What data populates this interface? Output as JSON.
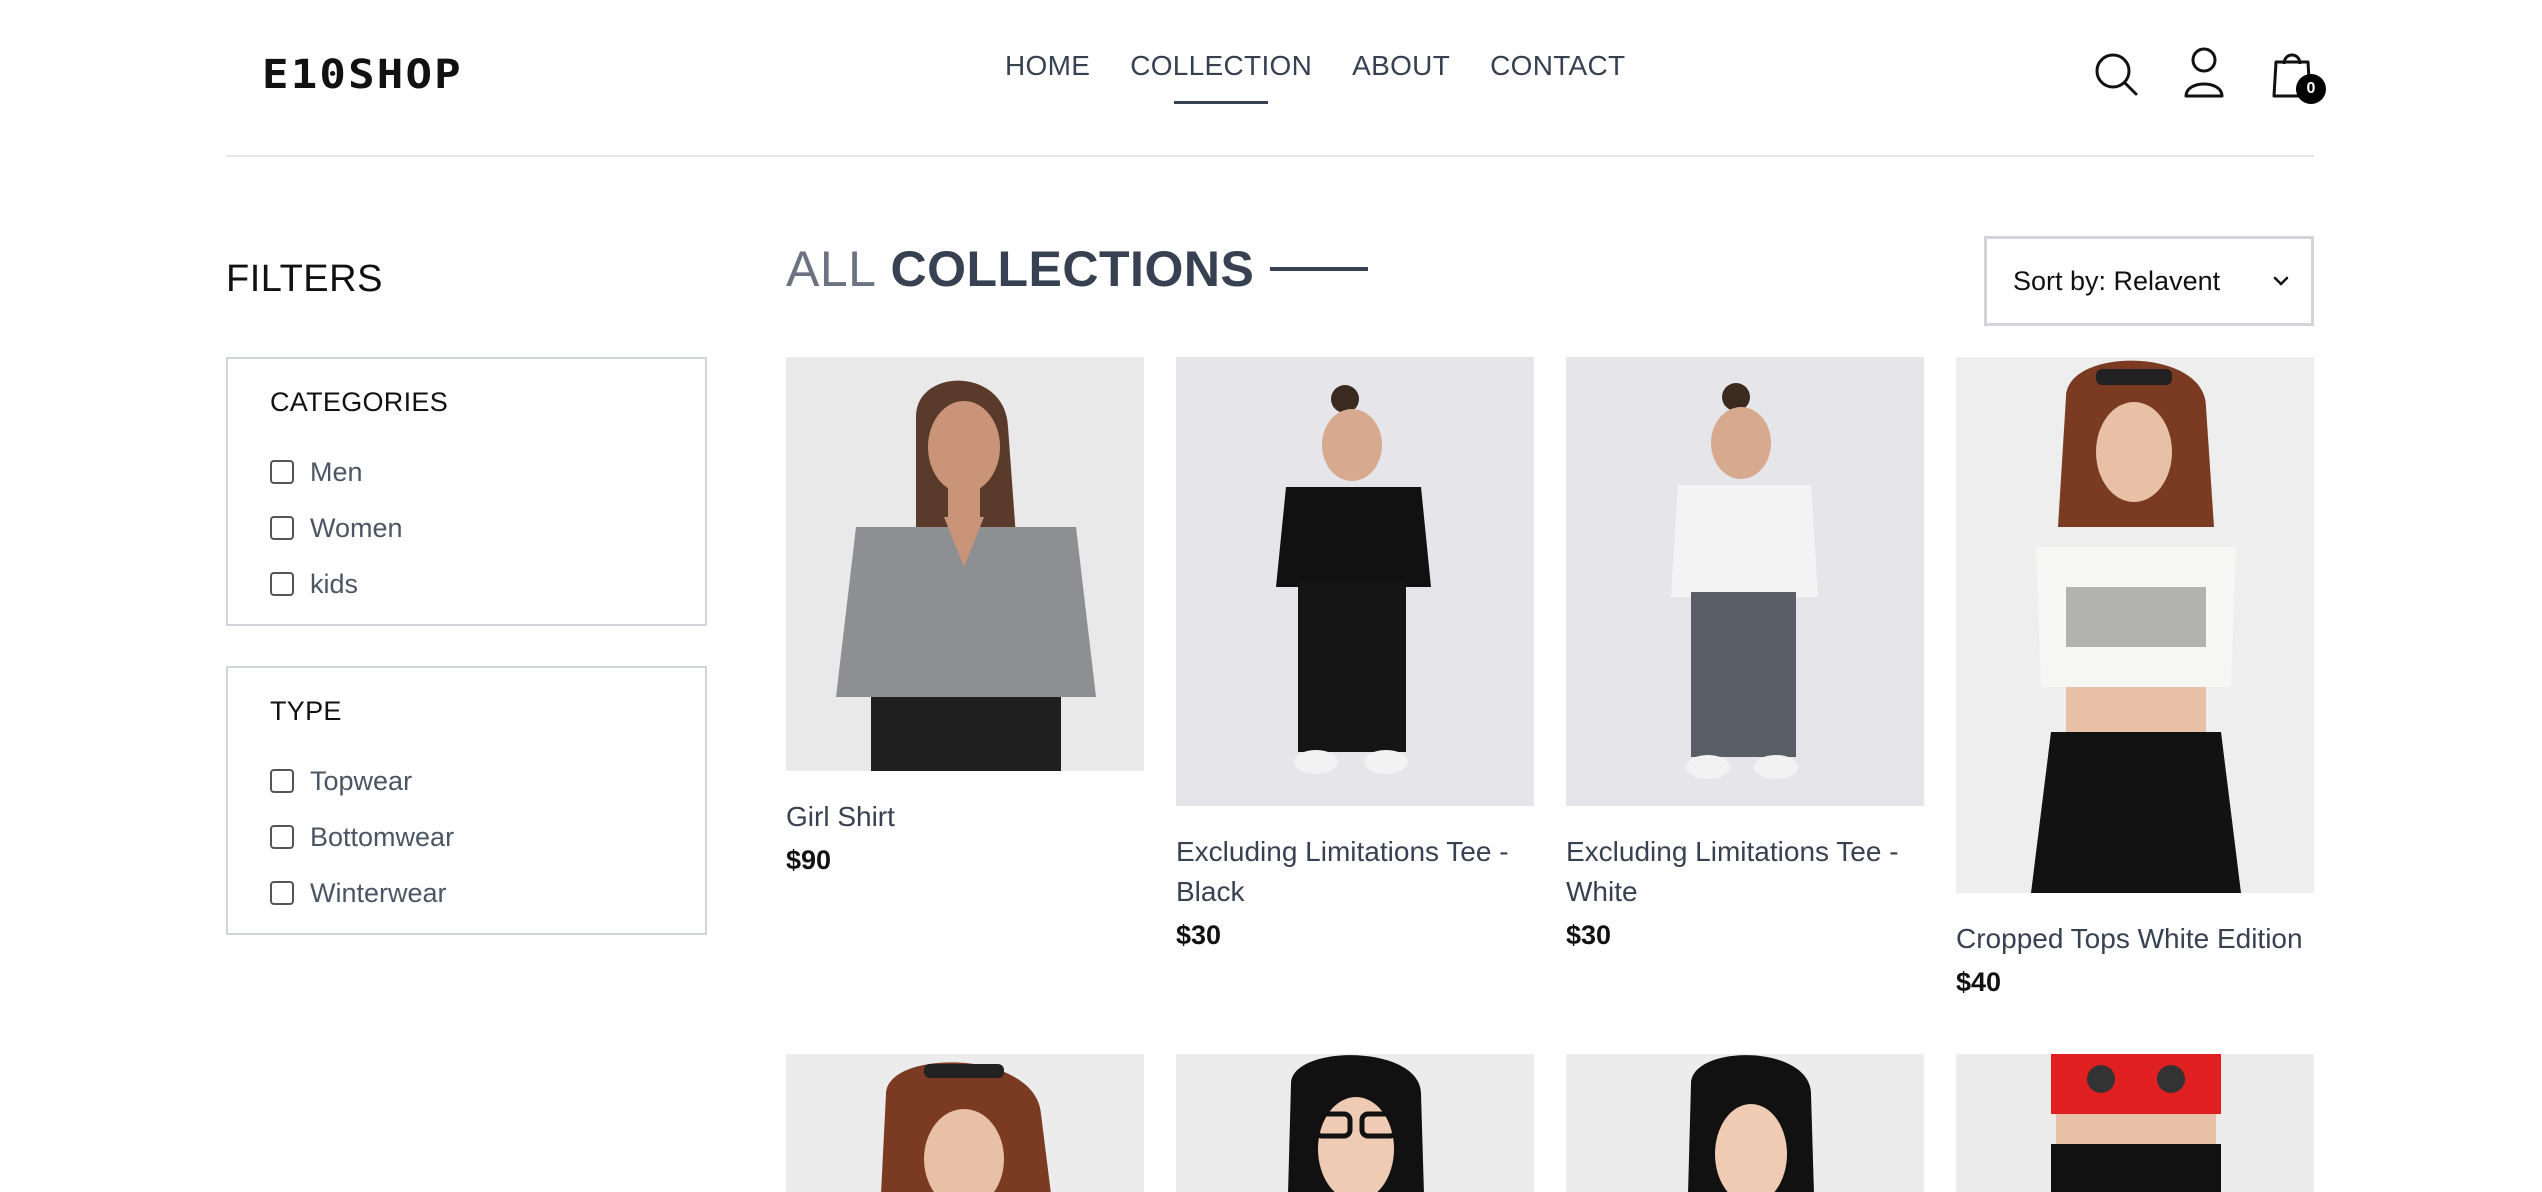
{
  "header": {
    "logo": "E10SHOP",
    "nav": [
      "HOME",
      "COLLECTION",
      "ABOUT",
      "CONTACT"
    ],
    "active_nav": "COLLECTION",
    "cart_count": "0",
    "icons": [
      "search-icon",
      "user-icon",
      "cart-icon"
    ]
  },
  "filters": {
    "title": "FILTERS",
    "categories": {
      "heading": "CATEGORIES",
      "options": [
        "Men",
        "Women",
        "kids"
      ]
    },
    "type": {
      "heading": "TYPE",
      "options": [
        "Topwear",
        "Bottomwear",
        "Winterwear"
      ]
    }
  },
  "main": {
    "title_light": "ALL",
    "title_bold": "COLLECTIONS",
    "sort_label": "Sort by: Relavent"
  },
  "products": [
    {
      "name": "Girl Shirt",
      "price": "$90"
    },
    {
      "name": "Excluding Limitations Tee - Black",
      "price": "$30"
    },
    {
      "name": "Excluding Limitations Tee - White",
      "price": "$30"
    },
    {
      "name": "Cropped Tops White Edition",
      "price": "$40"
    }
  ],
  "colors": {
    "text": "#374151",
    "border": "#d1d5db",
    "image_bg": "#efefef"
  }
}
